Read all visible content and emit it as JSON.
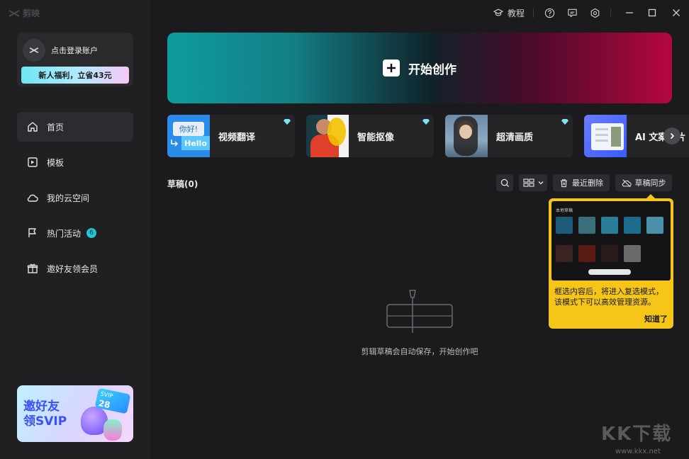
{
  "app": {
    "name": "剪映"
  },
  "account": {
    "login_text": "点击登录账户",
    "promo": "新人福利，立省43元"
  },
  "sidebar": {
    "items": [
      {
        "label": "首页",
        "icon": "home-icon",
        "active": true
      },
      {
        "label": "模板",
        "icon": "template-icon"
      },
      {
        "label": "我的云空间",
        "icon": "cloud-icon"
      },
      {
        "label": "热门活动",
        "icon": "flag-icon",
        "badge": "6"
      },
      {
        "label": "邀好友领会员",
        "icon": "gift-icon"
      }
    ],
    "banner": {
      "line1": "邀好友",
      "line2": "领SVIP",
      "card_label": "SVIP",
      "card_value": "28"
    }
  },
  "topbar": {
    "tutorial_label": "教程"
  },
  "hero": {
    "label": "开始创作"
  },
  "features": [
    {
      "label": "视频翻译",
      "thumb_text1": "你好!",
      "thumb_text2": "Hello"
    },
    {
      "label": "智能抠像"
    },
    {
      "label": "超清画质"
    },
    {
      "label": "AI 文案成片"
    }
  ],
  "drafts": {
    "title": "草稿(0)",
    "recent_delete": "最近删除",
    "sync": "草稿同步",
    "empty_text": "剪辑草稿会自动保存，开始创作吧"
  },
  "tooltip": {
    "line1": "框选内容后，将进入复选模式，",
    "line2": "该模式下可以高效管理资源。",
    "button": "知道了",
    "mini_title": "本地草稿"
  },
  "watermark": {
    "text": "KK下载",
    "url": "www.kkx.net"
  },
  "colors": {
    "accent_cyan": "#1fc7d4",
    "tooltip_yellow": "#f5c518",
    "hero_start": "#0f9c9c",
    "hero_end": "#b5073f"
  }
}
